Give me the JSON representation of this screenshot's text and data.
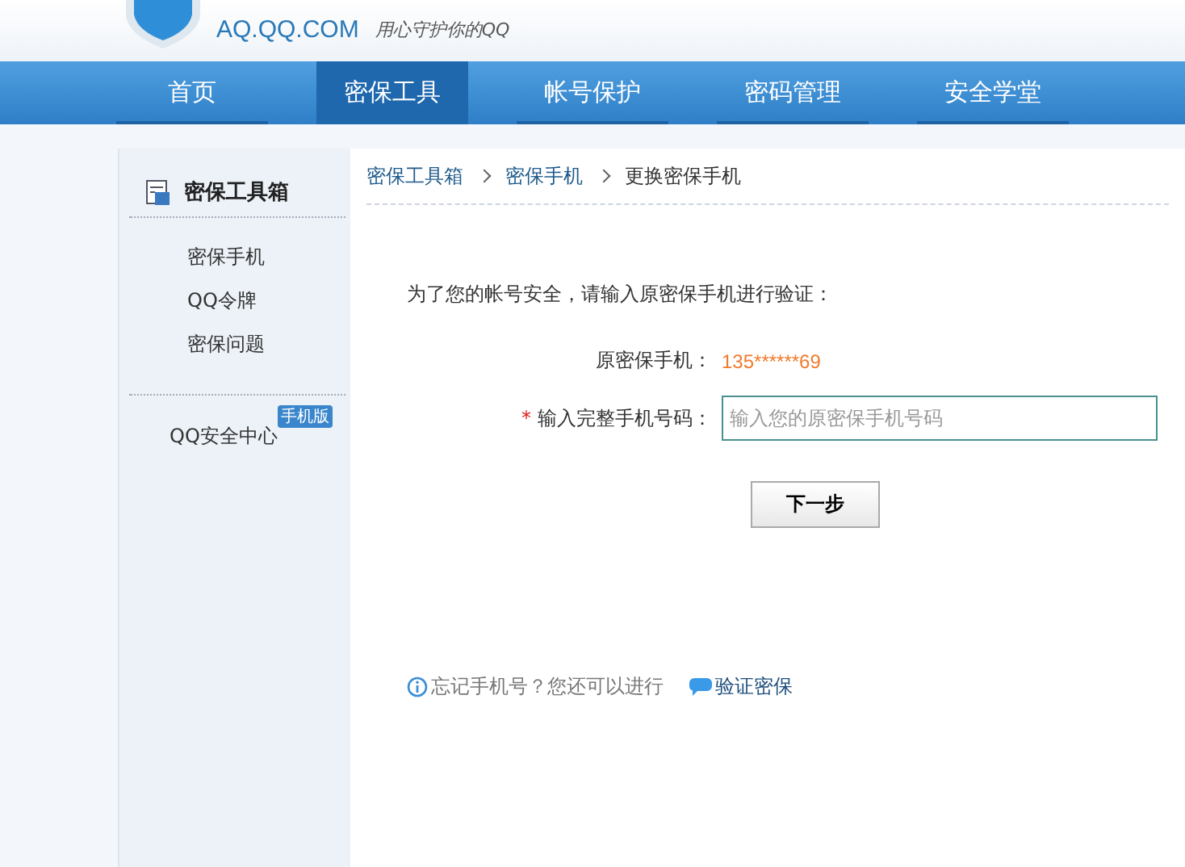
{
  "header": {
    "site": "AQ.QQ.COM",
    "slogan": "用心守护你的QQ"
  },
  "nav": [
    {
      "label": "首页",
      "selected": false
    },
    {
      "label": "密保工具",
      "selected": true
    },
    {
      "label": "帐号保护",
      "selected": false
    },
    {
      "label": "密码管理",
      "selected": false
    },
    {
      "label": "安全学堂",
      "selected": false
    }
  ],
  "sidebar": {
    "title": "密保工具箱",
    "items": [
      "密保手机",
      "QQ令牌",
      "密保问题"
    ],
    "extra": {
      "label": "QQ安全中心",
      "badge": "手机版"
    }
  },
  "breadcrumb": [
    "密保工具箱",
    "密保手机",
    "更换密保手机"
  ],
  "intro": "为了您的帐号安全，请输入原密保手机进行验证：",
  "form": {
    "phone_label": "原密保手机：",
    "phone_value": "135******69",
    "input_required": "*",
    "input_label": "输入完整手机号码：",
    "input_placeholder": "输入您的原密保手机号码",
    "button": "下一步"
  },
  "help": {
    "text": "忘记手机号？您还可以进行",
    "link": "验证密保"
  }
}
